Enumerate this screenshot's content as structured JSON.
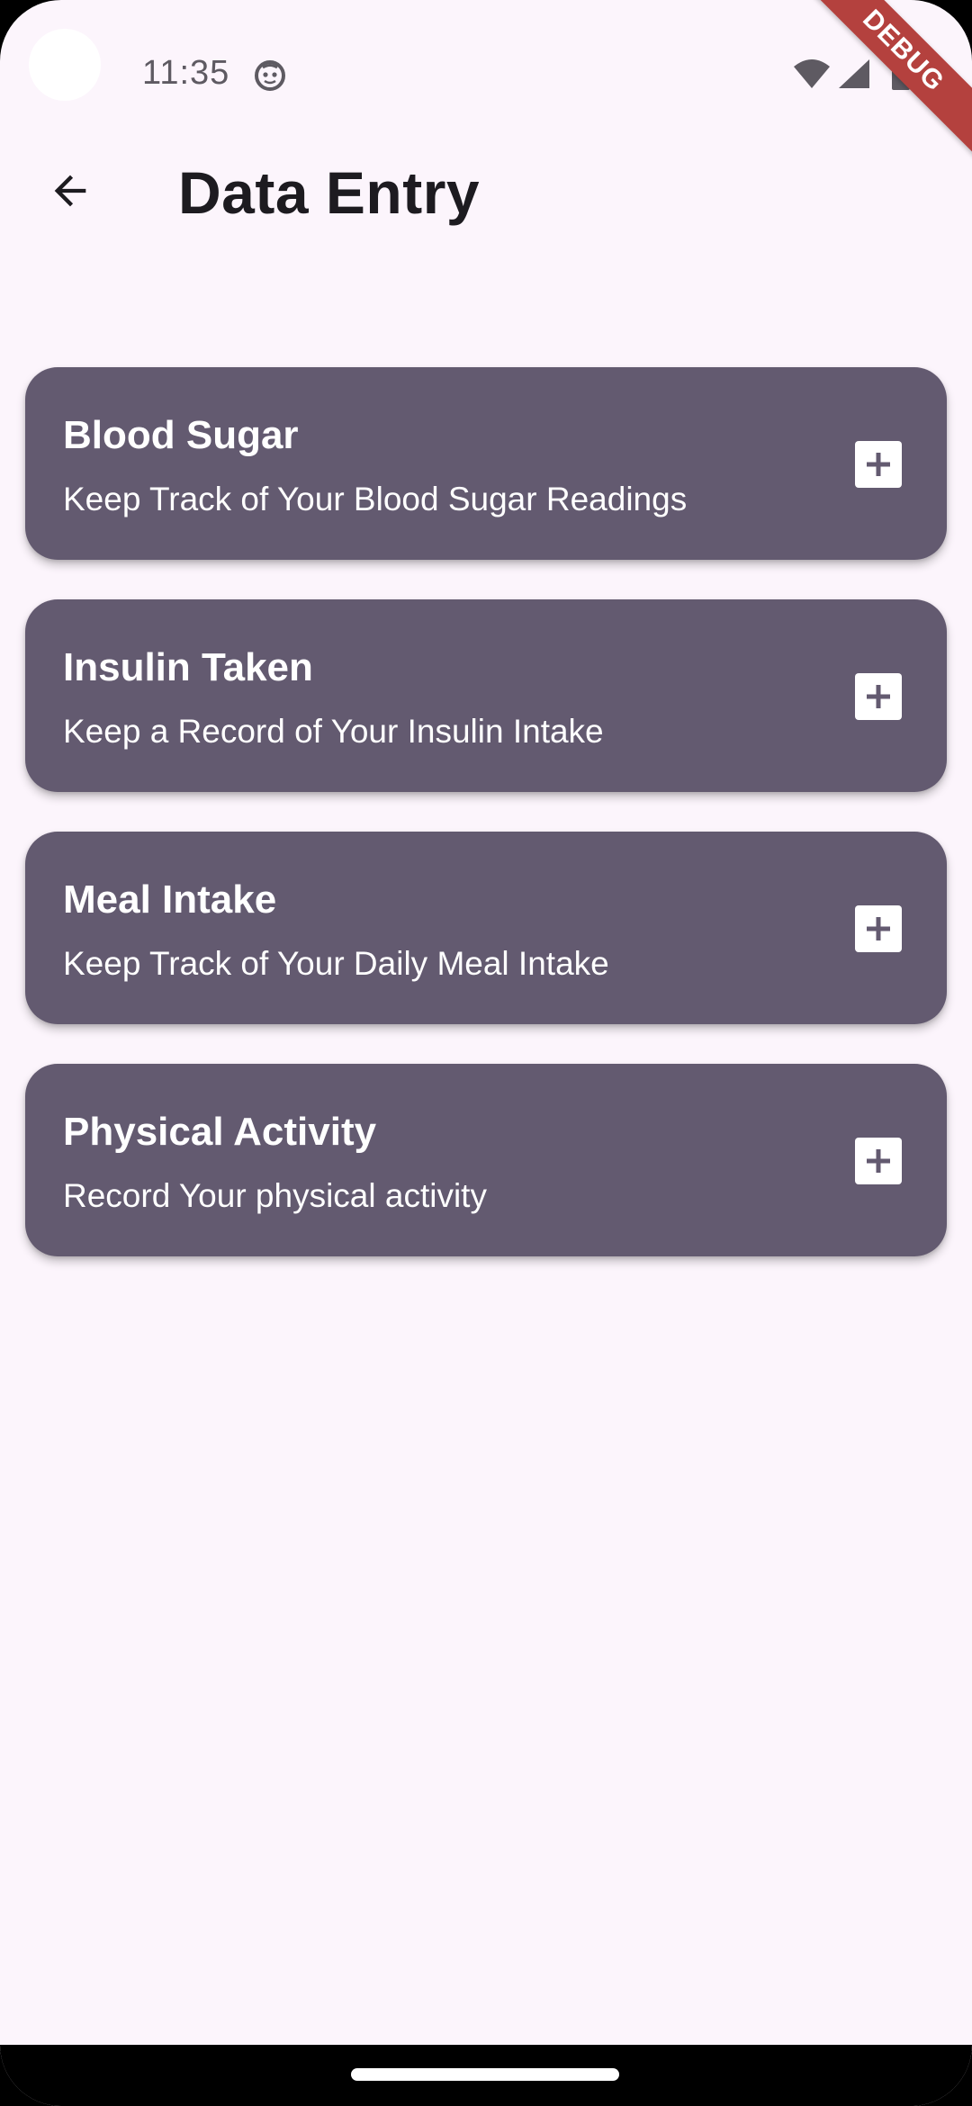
{
  "status_bar": {
    "time": "11:35",
    "icons": [
      "camera-cutout",
      "app-notification-icon",
      "wifi-icon",
      "cellular-signal-icon",
      "battery-icon"
    ]
  },
  "debug_banner": {
    "label": "DEBUG",
    "color": "#B4413E"
  },
  "app_bar": {
    "back_icon": "arrow-back-icon",
    "title": "Data Entry"
  },
  "cards": [
    {
      "title": "Blood Sugar",
      "subtitle": "Keep Track of Your Blood Sugar Readings",
      "action_icon": "add-box-icon"
    },
    {
      "title": "Insulin Taken",
      "subtitle": "Keep a Record of Your Insulin Intake",
      "action_icon": "add-box-icon"
    },
    {
      "title": "Meal Intake",
      "subtitle": "Keep Track of Your Daily Meal Intake",
      "action_icon": "add-box-icon"
    },
    {
      "title": "Physical Activity",
      "subtitle": "Record Your physical activity",
      "action_icon": "add-box-icon"
    }
  ],
  "colors": {
    "background": "#FCF5FC",
    "card": "#635A70",
    "card_text": "#FFFFFF",
    "title_text": "#1D1B20",
    "status_text": "#5E5A62"
  }
}
